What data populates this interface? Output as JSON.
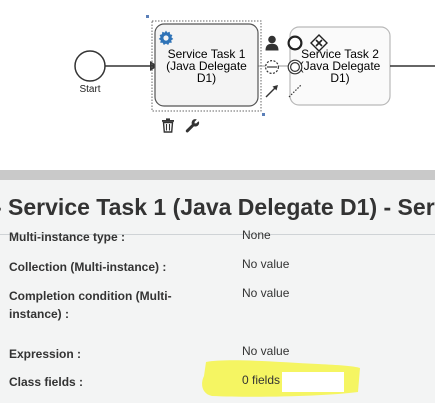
{
  "diagram": {
    "start_event_label": "Start",
    "task1": {
      "label_line1": "Service Task 1",
      "label_line2": "(Java Delegate",
      "label_line3": "D1)"
    },
    "task2": {
      "label_line1": "Service Task 2",
      "label_line2": "(Java Delegate",
      "label_line3": "D1)"
    },
    "context_icons": [
      "delete-icon",
      "wrench-icon",
      "gear-icon",
      "user-icon",
      "end-event-icon",
      "gateway-icon",
      "intermediate-event-icon",
      "boundary-event-icon",
      "arrow-icon",
      "annotation-icon"
    ]
  },
  "panel": {
    "title": "- Service Task 1 (Java Delegate D1) - Serv",
    "properties": [
      {
        "label": "Multi-instance type :",
        "value": "None"
      },
      {
        "label": "Collection (Multi-instance) :",
        "value": "No value"
      },
      {
        "label": "Completion condition (Multi-instance) :",
        "value": "No value"
      },
      {
        "label": "Expression :",
        "value": "No value"
      },
      {
        "label": "Class fields :",
        "value": "0 fields"
      }
    ]
  },
  "colors": {
    "highlight": "#f4f45a",
    "gear": "#2f73b7",
    "separator": "#c9c9c9",
    "panel_bg": "#f3f4f4"
  }
}
